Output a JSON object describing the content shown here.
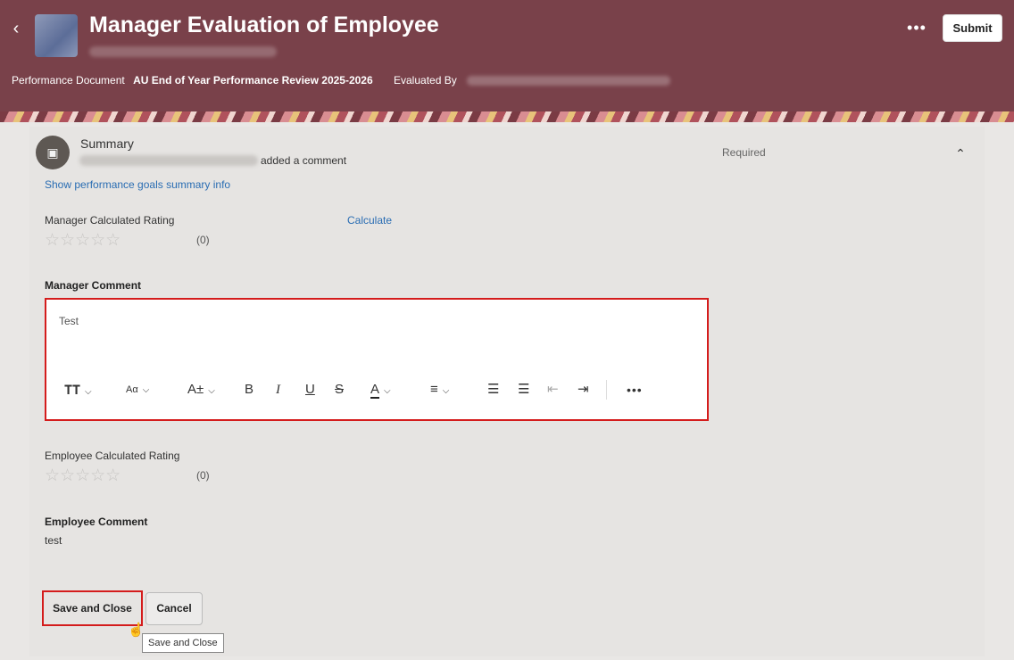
{
  "header": {
    "back_icon": "chevron-left-icon",
    "title": "Manager Evaluation of Employee",
    "performance_document_label": "Performance Document",
    "performance_document_value": "AU End of Year Performance Review 2025-2026",
    "evaluated_by_label": "Evaluated By",
    "more_label": "•••",
    "submit_label": "Submit",
    "header_color": "#79414a"
  },
  "summary": {
    "title": "Summary",
    "added_comment": "added a comment",
    "required": "Required",
    "show_goals_link": "Show performance goals summary info",
    "manager_rating_label": "Manager Calculated Rating",
    "calculate_link": "Calculate",
    "manager_rating_count": "(0)",
    "manager_rating_value": 0,
    "manager_comment_label": "Manager Comment",
    "manager_comment_value": "Test",
    "employee_rating_label": "Employee Calculated Rating",
    "employee_rating_count": "(0)",
    "employee_rating_value": 0,
    "employee_comment_label": "Employee Comment",
    "employee_comment_value": "test"
  },
  "stars": "☆☆☆☆☆",
  "editor_toolbar": [
    "text-size-icon",
    "font-size-icon",
    "superscript-icon",
    "bold-icon",
    "italic-icon",
    "underline-icon",
    "strikethrough-icon",
    "font-color-icon",
    "align-icon",
    "bulleted-list-icon",
    "numbered-list-icon",
    "outdent-icon",
    "indent-icon",
    "more-icon"
  ],
  "actions": {
    "save_close": "Save and Close",
    "cancel": "Cancel",
    "tooltip": "Save and Close"
  },
  "colors": {
    "highlight": "#d41c1c",
    "link": "#2a6db3"
  }
}
